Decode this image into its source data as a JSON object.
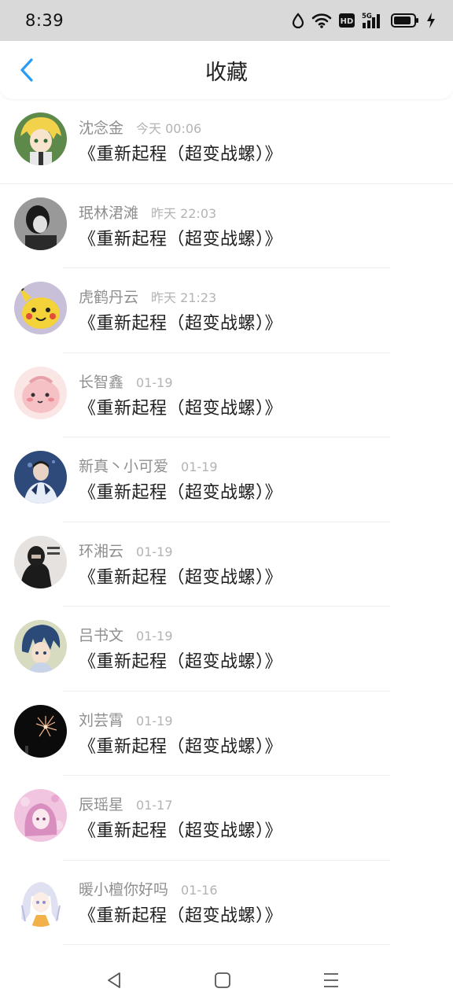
{
  "status_bar": {
    "time": "8:39",
    "icons": [
      "drop-icon",
      "wifi-icon",
      "hd-icon",
      "signal-5g-icon",
      "battery-icon",
      "charging-icon"
    ],
    "hd_label": "HD",
    "network_label": "5G"
  },
  "header": {
    "title": "收藏",
    "accent_color": "#2b9bf4"
  },
  "favorites": [
    {
      "name": "沈念金",
      "time": "今天 00:06",
      "content": "《重新起程（超变战螺）》"
    },
    {
      "name": "珉林涒滩",
      "time": "昨天 22:03",
      "content": "《重新起程（超变战螺）》"
    },
    {
      "name": "虎鹤丹云",
      "time": "昨天 21:23",
      "content": "《重新起程（超变战螺）》"
    },
    {
      "name": "长智鑫",
      "time": "01-19",
      "content": "《重新起程（超变战螺）》"
    },
    {
      "name": "新真丶小可爱",
      "time": "01-19",
      "content": "《重新起程（超变战螺）》"
    },
    {
      "name": "环湘云",
      "time": "01-19",
      "content": "《重新起程（超变战螺）》"
    },
    {
      "name": "吕书文",
      "time": "01-19",
      "content": "《重新起程（超变战螺）》"
    },
    {
      "name": "刘芸霄",
      "time": "01-19",
      "content": "《重新起程（超变战螺）》"
    },
    {
      "name": "辰瑶星",
      "time": "01-17",
      "content": "《重新起程（超变战螺）》"
    },
    {
      "name": "暖小檀你好吗",
      "time": "01-16",
      "content": "《重新起程（超变战螺）》"
    }
  ],
  "avatar_colors": [
    "#4a7a3a",
    "#3c3c3c",
    "#e3c93a",
    "#f7c6c6",
    "#3a5a8a",
    "#2a2a2a",
    "#3b5f8f",
    "#111111",
    "#e8a9d3",
    "#d9dcf0"
  ],
  "nav_bar": {
    "icons": [
      "back-triangle-icon",
      "home-square-icon",
      "menu-lines-icon"
    ]
  }
}
